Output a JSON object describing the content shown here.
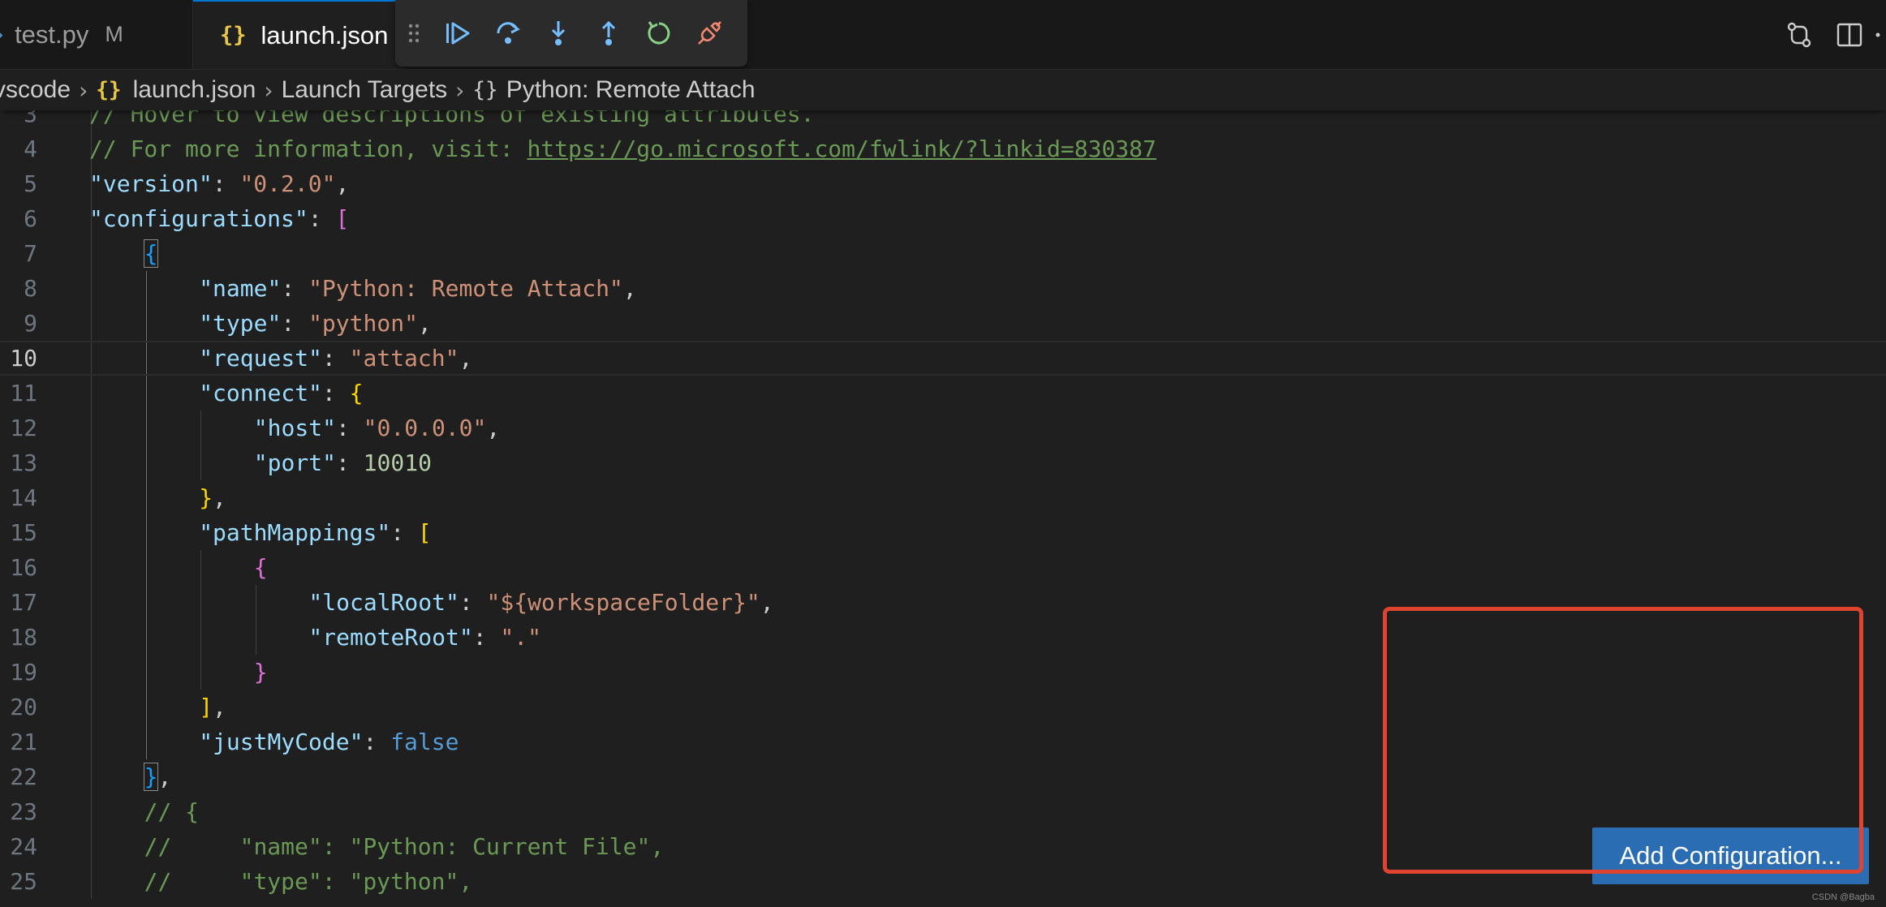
{
  "tabs": [
    {
      "label": "test.py",
      "icon": "python-file-icon",
      "badge": "M"
    },
    {
      "label": "launch.json",
      "icon": "json-file-icon",
      "active": true
    }
  ],
  "debug_toolbar": {
    "items": [
      "drag-grip-icon",
      "continue-icon",
      "step-over-icon",
      "step-into-icon",
      "step-out-icon",
      "restart-icon",
      "disconnect-icon"
    ]
  },
  "breadcrumb": {
    "items": [
      "vscode",
      "launch.json",
      "Launch Targets",
      "Python: Remote Attach"
    ]
  },
  "editor": {
    "current_line": 10,
    "lines": [
      {
        "n": "3",
        "tokens": [
          [
            "com",
            "// Hover to view descriptions of existing attributes."
          ]
        ]
      },
      {
        "n": "4",
        "tokens": [
          [
            "com",
            "// For more information, visit: "
          ],
          [
            "link",
            "https://go.microsoft.com/fwlink/?linkid=830387"
          ]
        ]
      },
      {
        "n": "5",
        "tokens": [
          [
            "key",
            "\"version\""
          ],
          [
            "pun",
            ": "
          ],
          [
            "str",
            "\"0.2.0\""
          ],
          [
            "pun",
            ","
          ]
        ]
      },
      {
        "n": "6",
        "tokens": [
          [
            "key",
            "\"configurations\""
          ],
          [
            "pun",
            ": "
          ],
          [
            "b2",
            "["
          ]
        ]
      },
      {
        "n": "7",
        "tokens": [
          [
            "b3m",
            "{"
          ]
        ]
      },
      {
        "n": "8",
        "tokens": [
          [
            "key",
            "\"name\""
          ],
          [
            "pun",
            ": "
          ],
          [
            "str",
            "\"Python: Remote Attach\""
          ],
          [
            "pun",
            ","
          ]
        ]
      },
      {
        "n": "9",
        "tokens": [
          [
            "key",
            "\"type\""
          ],
          [
            "pun",
            ": "
          ],
          [
            "str",
            "\"python\""
          ],
          [
            "pun",
            ","
          ]
        ]
      },
      {
        "n": "10",
        "tokens": [
          [
            "key",
            "\"request\""
          ],
          [
            "pun",
            ": "
          ],
          [
            "str",
            "\"attach\""
          ],
          [
            "pun",
            ","
          ]
        ]
      },
      {
        "n": "11",
        "tokens": [
          [
            "key",
            "\"connect\""
          ],
          [
            "pun",
            ": "
          ],
          [
            "b1",
            "{"
          ]
        ]
      },
      {
        "n": "12",
        "tokens": [
          [
            "key",
            "\"host\""
          ],
          [
            "pun",
            ": "
          ],
          [
            "str",
            "\"0.0.0.0\""
          ],
          [
            "pun",
            ","
          ]
        ]
      },
      {
        "n": "13",
        "tokens": [
          [
            "key",
            "\"port\""
          ],
          [
            "pun",
            ": "
          ],
          [
            "num",
            "10010"
          ]
        ]
      },
      {
        "n": "14",
        "tokens": [
          [
            "b1",
            "}"
          ],
          [
            "pun",
            ","
          ]
        ]
      },
      {
        "n": "15",
        "tokens": [
          [
            "key",
            "\"pathMappings\""
          ],
          [
            "pun",
            ": "
          ],
          [
            "b1",
            "["
          ]
        ]
      },
      {
        "n": "16",
        "tokens": [
          [
            "b2",
            "{"
          ]
        ]
      },
      {
        "n": "17",
        "tokens": [
          [
            "key",
            "\"localRoot\""
          ],
          [
            "pun",
            ": "
          ],
          [
            "str",
            "\"${workspaceFolder}\""
          ],
          [
            "pun",
            ","
          ]
        ]
      },
      {
        "n": "18",
        "tokens": [
          [
            "key",
            "\"remoteRoot\""
          ],
          [
            "pun",
            ": "
          ],
          [
            "str",
            "\".\""
          ]
        ]
      },
      {
        "n": "19",
        "tokens": [
          [
            "b2",
            "}"
          ]
        ]
      },
      {
        "n": "20",
        "tokens": [
          [
            "b1",
            "]"
          ],
          [
            "pun",
            ","
          ]
        ]
      },
      {
        "n": "21",
        "tokens": [
          [
            "key",
            "\"justMyCode\""
          ],
          [
            "pun",
            ": "
          ],
          [
            "kw",
            "false"
          ]
        ]
      },
      {
        "n": "22",
        "tokens": [
          [
            "b3m",
            "}"
          ],
          [
            "pun",
            ","
          ]
        ]
      },
      {
        "n": "23",
        "tokens": [
          [
            "com",
            "// {"
          ]
        ]
      },
      {
        "n": "24",
        "tokens": [
          [
            "com",
            "//     \"name\": \"Python: Current File\","
          ]
        ]
      },
      {
        "n": "25",
        "tokens": [
          [
            "com",
            "//     \"type\": \"python\","
          ]
        ]
      }
    ]
  },
  "add_configuration": {
    "label": "Add Configuration..."
  },
  "watermark": "CSDN @Bagba"
}
